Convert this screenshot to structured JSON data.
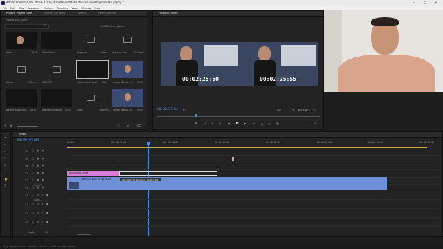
{
  "app": {
    "title": "Adobe Premiere Pro 2019 - C:\\Usuarios\\Daniel\\Área de Trabalho\\Projeto Base.prproj *"
  },
  "menu": [
    "File",
    "Edit",
    "Clip",
    "Sequence",
    "Markers",
    "Graphics",
    "View",
    "Window",
    "Help"
  ],
  "project": {
    "tabs": [
      "Project: Projeto Base",
      "Source: (no clips)",
      "Effects",
      "Effect Controls"
    ],
    "path": "Projeto Base.prproj",
    "items_selected": "1 of 27 items selected",
    "items": [
      {
        "name": "Video",
        "info": "2474"
      },
      {
        "name": "Efeito Sonor",
        "info": ""
      },
      {
        "name": "Originais",
        "info": "4 items"
      },
      {
        "name": "Arquivos Proj...",
        "info": "11 items"
      },
      {
        "name": "Audios",
        "info": "1 items"
      },
      {
        "name": "4K3 NOTI",
        "info": ""
      },
      {
        "name": "Adjustment Layer",
        "info": "300"
      },
      {
        "name": "Projeto Base Linh...",
        "info": "25:55"
      },
      {
        "name": "Nested Sequence...",
        "info": "06:13"
      },
      {
        "name": "Regin Bas Arq.png",
        "info": "01:05"
      },
      {
        "name": "Audio",
        "info": "16 items"
      },
      {
        "name": "Projeto Base Linh...",
        "info": "25:55"
      }
    ]
  },
  "program": {
    "tab": "Program: Video",
    "timecode_left": "00:02:25:50",
    "timecode_right": "00:02:25:55",
    "current": "00:00:07:56",
    "fit": "Fit",
    "full": "Full",
    "duration": "00:00:51:14"
  },
  "timeline": {
    "tab": "Video",
    "timecode": "00:00:07:56",
    "ruler": [
      "00:00",
      "00:00:05:00",
      "00:00:10:00",
      "00:00:15:00",
      "00:00:20:00",
      "00:00:25:00",
      "00:00:30:00",
      "00:00:35:00"
    ],
    "tracks": {
      "v": [
        "V6",
        "V5",
        "V4",
        "V3",
        "V2",
        "V1"
      ],
      "a": [
        "A1",
        "A2",
        "A3",
        "A4"
      ]
    },
    "v1_label": "Video 1",
    "a1_label": "Audio 1",
    "master": "Master",
    "master_val": "0.0",
    "clips": {
      "adjustment": "Adjustment Layer",
      "video": "VIDEO (V).MOV [V] 28:28.xml",
      "tooltip": "+00:00:07:61  Duration: 00:00:53:61"
    }
  },
  "status": {
    "hint": "Drag edge to trim the selection. Use Alt and Ctrl for other options."
  }
}
